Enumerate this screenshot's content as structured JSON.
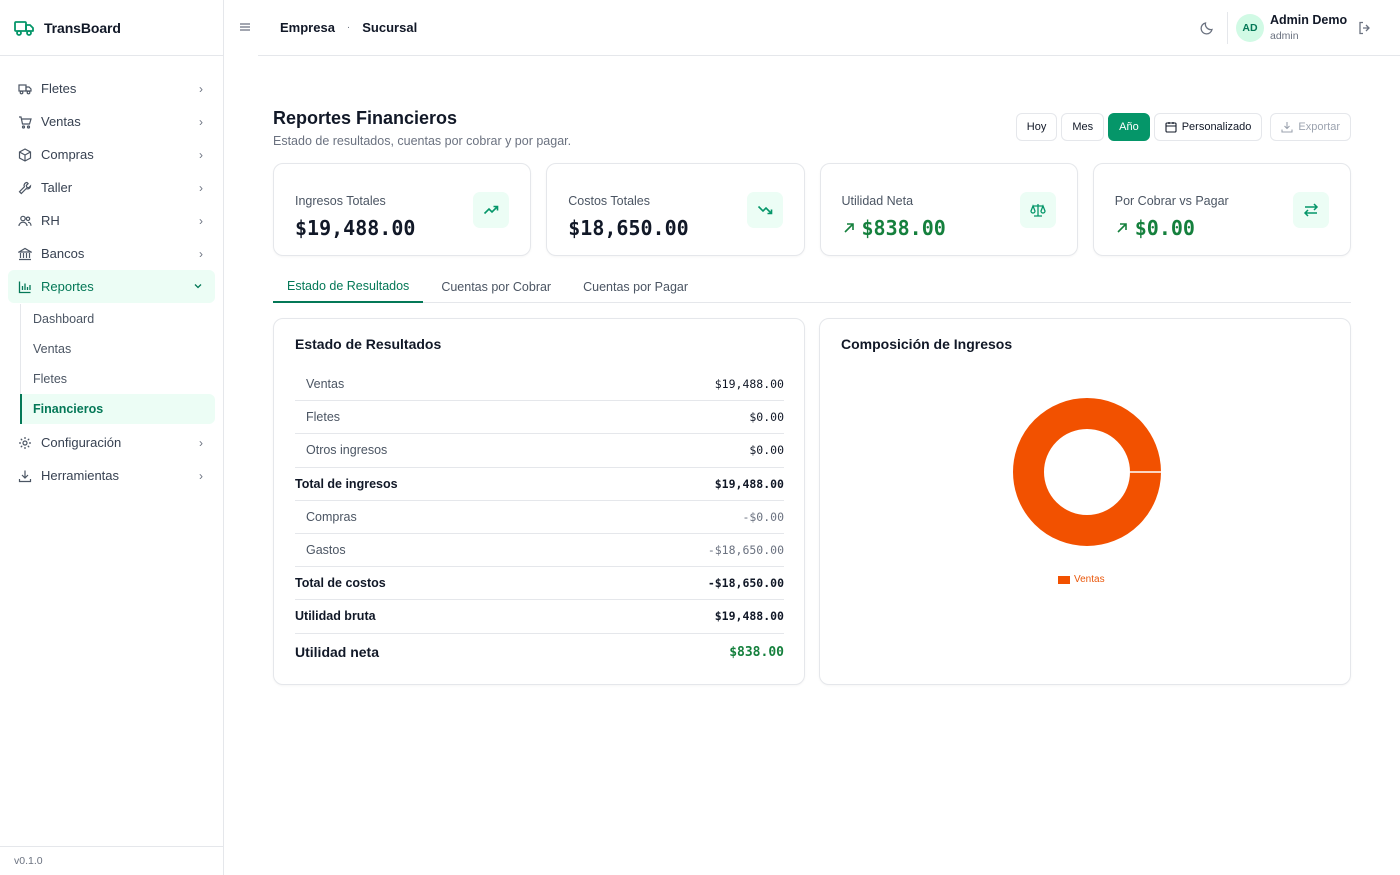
{
  "brand": {
    "name": "TransBoard",
    "color": "#059669"
  },
  "sidebar": {
    "items": [
      {
        "label": "Fletes",
        "icon": "truck-icon"
      },
      {
        "label": "Ventas",
        "icon": "cart-icon"
      },
      {
        "label": "Compras",
        "icon": "package-icon"
      },
      {
        "label": "Taller",
        "icon": "wrench-icon"
      },
      {
        "label": "RH",
        "icon": "users-icon"
      },
      {
        "label": "Bancos",
        "icon": "bank-icon"
      },
      {
        "label": "Reportes",
        "icon": "bar-chart-icon"
      },
      {
        "label": "Configuración",
        "icon": "gear-icon"
      },
      {
        "label": "Herramientas",
        "icon": "download-icon"
      }
    ],
    "reportes_sub": [
      {
        "label": "Dashboard"
      },
      {
        "label": "Ventas"
      },
      {
        "label": "Fletes"
      },
      {
        "label": "Financieros"
      }
    ],
    "version": "v0.1.0"
  },
  "topbar": {
    "breadcrumb": [
      "Empresa",
      "Sucursal"
    ],
    "user": {
      "initials": "AD",
      "name": "Admin Demo",
      "role": "admin"
    }
  },
  "page": {
    "title": "Reportes Financieros",
    "subtitle": "Estado de resultados, cuentas por cobrar y por pagar.",
    "ranges": [
      "Hoy",
      "Mes",
      "Año"
    ],
    "active_range": "Año",
    "custom_label": "Personalizado",
    "export_label": "Exportar"
  },
  "cards": [
    {
      "label": "Ingresos Totales",
      "value": "$19,488.00",
      "icon": "trending-up-icon"
    },
    {
      "label": "Costos Totales",
      "value": "$18,650.00",
      "icon": "trending-down-icon"
    },
    {
      "label": "Utilidad Neta",
      "value": "$838.00",
      "icon": "scale-icon"
    },
    {
      "label": "Por Cobrar vs Pagar",
      "value": "$0.00",
      "icon": "arrows-exchange-icon"
    }
  ],
  "tabs": [
    "Estado de Resultados",
    "Cuentas por Cobrar",
    "Cuentas por Pagar"
  ],
  "statement": {
    "title": "Estado de Resultados",
    "rows": [
      {
        "label": "Ventas",
        "value": "$19,488.00"
      },
      {
        "label": "Fletes",
        "value": "$0.00"
      },
      {
        "label": "Otros ingresos",
        "value": "$0.00"
      },
      {
        "label": "Total de ingresos",
        "value": "$19,488.00"
      },
      {
        "label": "Compras",
        "value": "-$0.00"
      },
      {
        "label": "Gastos",
        "value": "-$18,650.00"
      },
      {
        "label": "Total de costos",
        "value": "-$18,650.00"
      },
      {
        "label": "Utilidad bruta",
        "value": "$19,488.00"
      },
      {
        "label": "Utilidad neta",
        "value": "$838.00"
      }
    ]
  },
  "composition": {
    "title": "Composición de Ingresos",
    "chart_data": {
      "type": "pie",
      "categories": [
        "Ventas"
      ],
      "values": [
        19488
      ],
      "colors": [
        "#f25100"
      ],
      "legend": "bottom"
    }
  }
}
